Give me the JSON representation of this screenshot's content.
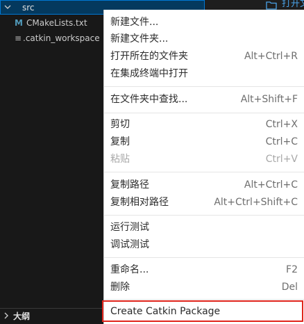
{
  "explorer": {
    "folder_label": "src",
    "files": [
      {
        "icon": "M",
        "label": "CMakeLists.txt"
      },
      {
        "icon": "≡",
        "label": ".catkin_workspace"
      }
    ],
    "outline_label": "大纲"
  },
  "top_right": {
    "open_label": "打开文"
  },
  "menu": {
    "items": [
      {
        "label": "新建文件...",
        "shortcut": ""
      },
      {
        "label": "新建文件夹...",
        "shortcut": ""
      },
      {
        "label": "打开所在的文件夹",
        "shortcut": "Alt+Ctrl+R"
      },
      {
        "label": "在集成终端中打开",
        "shortcut": ""
      },
      {
        "label": "在文件夹中查找...",
        "shortcut": "Alt+Shift+F"
      },
      {
        "label": "剪切",
        "shortcut": "Ctrl+X"
      },
      {
        "label": "复制",
        "shortcut": "Ctrl+C"
      },
      {
        "label": "粘贴",
        "shortcut": "Ctrl+V"
      },
      {
        "label": "复制路径",
        "shortcut": "Alt+Ctrl+C"
      },
      {
        "label": "复制相对路径",
        "shortcut": "Alt+Ctrl+Shift+C"
      },
      {
        "label": "运行测试",
        "shortcut": ""
      },
      {
        "label": "调试测试",
        "shortcut": ""
      },
      {
        "label": "重命名...",
        "shortcut": "F2"
      },
      {
        "label": "删除",
        "shortcut": "Del"
      },
      {
        "label": "Create Catkin Package",
        "shortcut": ""
      }
    ]
  },
  "colors": {
    "selection_border": "#0078d4",
    "highlight_red": "#e0241b",
    "cmake_icon": "#519aba"
  }
}
